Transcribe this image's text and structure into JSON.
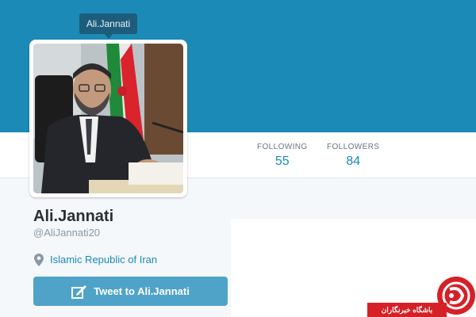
{
  "header": {
    "tooltip_name": "Ali.Jannati"
  },
  "stats": {
    "following_label": "FOLLOWING",
    "following_count": "55",
    "followers_label": "FOLLOWERS",
    "followers_count": "84"
  },
  "profile": {
    "name": "Ali.Jannati",
    "handle": "@AliJannati20",
    "location": "Islamic Republic of Iran",
    "location_icon": "map-pin-icon"
  },
  "actions": {
    "tweet_to_label": "Tweet to Ali.Jannati",
    "tweet_icon": "compose-icon"
  },
  "watermark": {
    "text": "باشگاه خبرنگاران"
  },
  "colors": {
    "banner": "#1b8ab6",
    "accent": "#1b8ab6",
    "tweet_button": "#4fa3c8",
    "watermark_red": "#d62027"
  }
}
